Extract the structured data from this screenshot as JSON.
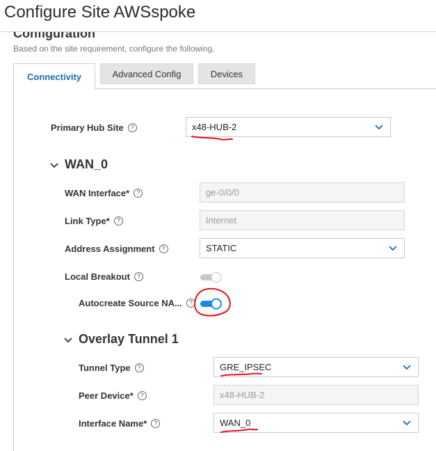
{
  "page": {
    "title": "Configure Site AWSspoke"
  },
  "section": {
    "title": "Configuration",
    "subtitle": "Based on the site requirement, configure the following."
  },
  "tabs": [
    {
      "label": "Connectivity",
      "active": true
    },
    {
      "label": "Advanced Config",
      "active": false
    },
    {
      "label": "Devices",
      "active": false
    }
  ],
  "primary_hub": {
    "label": "Primary Hub Site",
    "value": "x48-HUB-2"
  },
  "wan": {
    "title": "WAN_0",
    "interface": {
      "label": "WAN Interface*",
      "value": "ge-0/0/0"
    },
    "link_type": {
      "label": "Link Type*",
      "value": "Internet"
    },
    "address": {
      "label": "Address Assignment",
      "value": "STATIC"
    },
    "local_breakout": {
      "label": "Local Breakout",
      "on": false
    },
    "autocreate": {
      "label": "Autocreate Source NA...",
      "on": true
    }
  },
  "overlay": {
    "title": "Overlay Tunnel 1",
    "tunnel_type": {
      "label": "Tunnel Type",
      "value": "GRE_IPSEC"
    },
    "peer_device": {
      "label": "Peer Device*",
      "value": "x48-HUB-2"
    },
    "interface_name": {
      "label": "Interface Name*",
      "value": "WAN_0"
    }
  },
  "icons": {
    "help": "?",
    "chevron": "chevron-down-icon"
  },
  "colors": {
    "accent": "#1b6ea8",
    "toggle_on": "#1e88e5",
    "annotation": "#e0141c"
  }
}
